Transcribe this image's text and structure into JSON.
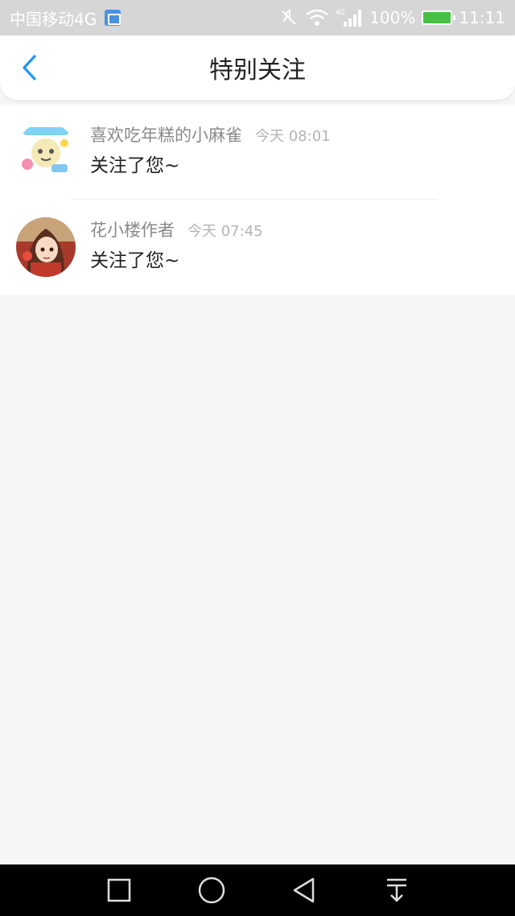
{
  "status_bar": {
    "carrier": "中国移动4G",
    "battery": "100%",
    "time": "11:11",
    "icons": [
      "image-icon",
      "mute-icon",
      "wifi-icon",
      "signal-4g-icon",
      "battery-charging-icon"
    ]
  },
  "header": {
    "title": "特别关注",
    "back_icon": "chevron-left-icon",
    "accent_color": "#2196f3"
  },
  "notifications": [
    {
      "name": "喜欢吃年糕的小麻雀",
      "time": "今天 08:01",
      "message": "关注了您~",
      "avatar": "cartoon-cat-avatar"
    },
    {
      "name": "花小楼作者",
      "time": "今天 07:45",
      "message": "关注了您~",
      "avatar": "anime-girl-avatar"
    }
  ],
  "nav_keys": [
    "recents-square-icon",
    "home-circle-icon",
    "back-triangle-icon",
    "notification-pulldown-icon"
  ]
}
